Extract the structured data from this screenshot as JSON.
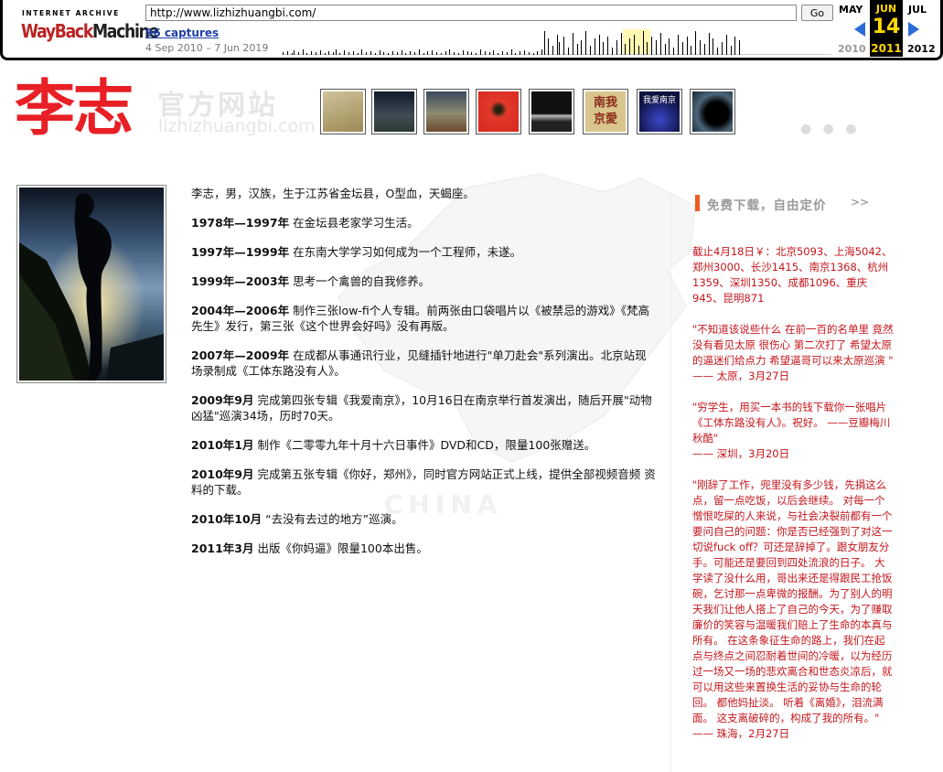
{
  "wayback": {
    "logo_top": "INTERNET ARCHIVE",
    "logo_way": "WayBack",
    "logo_machine": "Machine",
    "url": "http://www.lizhizhuangbi.com/",
    "go_label": "Go",
    "captures": "96 captures",
    "range": "4 Sep 2010 – 7 Jun 2019",
    "prev_month": "MAY",
    "cur_month": "JUN",
    "next_month": "JUL",
    "cur_day": "14",
    "prev_year": "2010",
    "cur_year": "2011",
    "next_year": "2012",
    "accent": "#ffd800"
  },
  "header": {
    "title": "李志",
    "subtitle": "官方网站",
    "domain": "lizhizhuangbi.com",
    "title_color": "#e81f25",
    "albums": [
      "album-1",
      "album-2",
      "album-3",
      "album-4",
      "album-5",
      "album-6",
      "album-7",
      "album-8"
    ]
  },
  "watermark": {
    "text": "CHINA"
  },
  "bio": {
    "intro": "李志，男，汉族，生于江苏省金坛县，O型血，天蝎座。",
    "entries": [
      {
        "year": "1978年—1997年",
        "text": " 在金坛县老家学习生活。"
      },
      {
        "year": "1997年—1999年",
        "text": " 在东南大学学习如何成为一个工程师，未遂。"
      },
      {
        "year": "1999年—2003年",
        "text": " 思考一个禽兽的自我修养。"
      },
      {
        "year": "2004年—2006年",
        "text": " 制作三张low-fi个人专辑。前两张由口袋唱片以《被禁忌的游戏》《梵高先生》发行，第三张《这个世界会好吗》没有再版。"
      },
      {
        "year": "2007年—2009年",
        "text": " 在成都从事通讯行业，见缝插针地进行\"单刀赴会\"系列演出。北京站现场录制成《工体东路没有人》。"
      },
      {
        "year": "2009年9月",
        "text": " 完成第四张专辑《我爱南京》，10月16日在南京举行首发演出，随后开展\"动物凶猛\"巡演34场，历时70天。"
      },
      {
        "year": "2010年1月",
        "text": " 制作《二零零九年十月十六日事件》DVD和CD，限量100张赠送。"
      },
      {
        "year": "2010年9月",
        "text": " 完成第五张专辑《你好，郑州》，同时官方网站正式上线，提供全部视频音频 资料的下载。"
      },
      {
        "year": "2010年10月",
        "text": " “去没有去过的地方”巡演。"
      },
      {
        "year": "2011年3月",
        "text": " 出版《你妈逼》限量100本出售。"
      }
    ]
  },
  "sidebar": {
    "title": "免费下载，自由定价",
    "more": ">>",
    "stats": "截止4月18日￥：北京5093、上海5042、郑州3000、长沙1415、南京1368、杭州1359、深圳1350、成都1096、重庆945、昆明871",
    "quotes": [
      {
        "text": "\"不知道该说些什么 在前一百的名单里 竟然没有看见太原 很伤心 第二次打了 希望太原的逼迷们给点力 希望逼哥可以来太原巡演 \"",
        "sig": "—— 太原，3月27日"
      },
      {
        "text": "\"穷学生，用买一本书的钱下载你一张唱片《工体东路没有人》。祝好。 ——豆瓣梅川秋酷\"",
        "sig": "—— 深圳，3月20日"
      },
      {
        "text": "\"刚辞了工作，兜里没有多少钱，先捐这么点，留一点吃饭，以后会继续。 对每一个憎恨吃屎的人来说，与社会决裂前都有一个要问自己的问题：你是否已经强到了对这一切说fuck off？可还是辞掉了。跟女朋友分手。可能还是要回到四处流浪的日子。 大学读了没什么用，哥出来还是得跟民工抢饭碗，乞讨那一点卑微的报酬。为了别人的明天我们让他人搭上了自己的今天，为了赚取廉价的笑容与温暖我们赔上了生命的本真与所有。 在这条象征生命的路上，我们在起点与终点之间忍耐着世间的冷暖，以为经历过一场又一场的悲欢离合和世态炎凉后，就可以用这些来置换生活的妥协与生命的轮回。 都他妈扯淡。 听着《离婚》，泪流满面。 这支离破碎的，构成了我的所有。\"",
        "sig": "—— 珠海，2月27日"
      }
    ]
  }
}
